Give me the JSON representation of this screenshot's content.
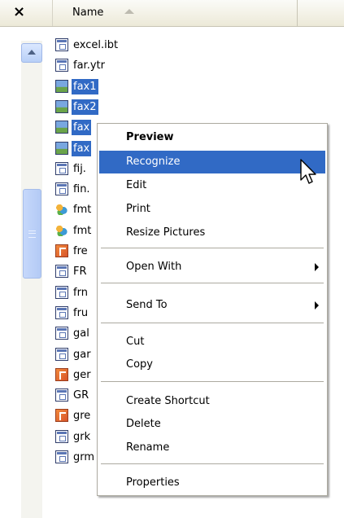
{
  "header": {
    "close_glyph": "×",
    "name_column": "Name"
  },
  "files": [
    {
      "name": "excel.ibt",
      "icon": "document-icon",
      "selected": false
    },
    {
      "name": "far.ytr",
      "icon": "document-icon",
      "selected": false
    },
    {
      "name": "fax1",
      "icon": "image-icon",
      "selected": true
    },
    {
      "name": "fax2",
      "icon": "image-icon",
      "selected": true
    },
    {
      "name": "fax",
      "icon": "image-icon",
      "selected": true
    },
    {
      "name": "fax",
      "icon": "image-icon",
      "selected": true
    },
    {
      "name": "fij.",
      "icon": "document-icon",
      "selected": false
    },
    {
      "name": "fin.",
      "icon": "document-icon",
      "selected": false
    },
    {
      "name": "fmt",
      "icon": "format-icon",
      "selected": false
    },
    {
      "name": "fmt",
      "icon": "format-icon",
      "selected": false
    },
    {
      "name": "fre",
      "icon": "font-icon",
      "selected": false
    },
    {
      "name": "FR",
      "icon": "document-icon",
      "selected": false
    },
    {
      "name": "frn",
      "icon": "document-icon",
      "selected": false
    },
    {
      "name": "fru",
      "icon": "document-icon",
      "selected": false
    },
    {
      "name": "gal",
      "icon": "document-icon",
      "selected": false
    },
    {
      "name": "gar",
      "icon": "document-icon",
      "selected": false
    },
    {
      "name": "ger",
      "icon": "font-icon",
      "selected": false
    },
    {
      "name": "GR",
      "icon": "document-icon",
      "selected": false
    },
    {
      "name": "gre",
      "icon": "font-icon",
      "selected": false
    },
    {
      "name": "grk",
      "icon": "document-icon",
      "selected": false
    },
    {
      "name": "grm",
      "icon": "document-icon",
      "selected": false
    }
  ],
  "context_menu": {
    "preview": "Preview",
    "recognize": "Recognize",
    "edit": "Edit",
    "print": "Print",
    "resize_pictures": "Resize Pictures",
    "open_with": "Open With",
    "send_to": "Send To",
    "cut": "Cut",
    "copy": "Copy",
    "create_shortcut": "Create Shortcut",
    "delete": "Delete",
    "rename": "Rename",
    "properties": "Properties",
    "highlighted": "Recognize",
    "highlight_color": "#316ac5"
  }
}
